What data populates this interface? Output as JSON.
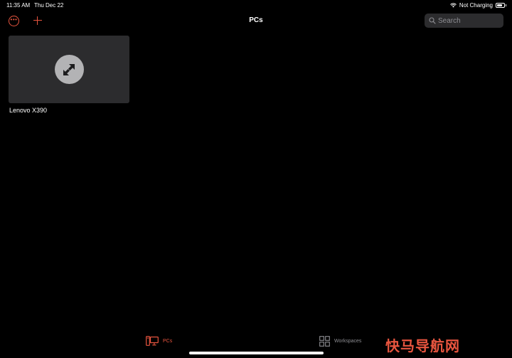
{
  "status_bar": {
    "time": "11:35 AM",
    "date": "Thu Dec 22",
    "charging_status": "Not Charging",
    "battery_level_pct": 80
  },
  "toolbar": {
    "title": "PCs",
    "more_icon": "ellipsis-circle-icon",
    "add_icon": "plus-icon",
    "search_placeholder": "Search"
  },
  "pcs": [
    {
      "name": "Lenovo X390",
      "icon": "remote-desktop-icon"
    }
  ],
  "tabs": [
    {
      "label": "PCs",
      "icon": "monitor-icon",
      "selected": true
    },
    {
      "label": "Workspaces",
      "icon": "grid-icon",
      "selected": false
    }
  ],
  "watermark": {
    "text": "快马导航网"
  },
  "colors": {
    "accent": "#e8553f",
    "background": "#000000",
    "tile": "#2c2c2e",
    "search_bg": "#2c2c2e",
    "muted_text": "#8e8e93"
  }
}
